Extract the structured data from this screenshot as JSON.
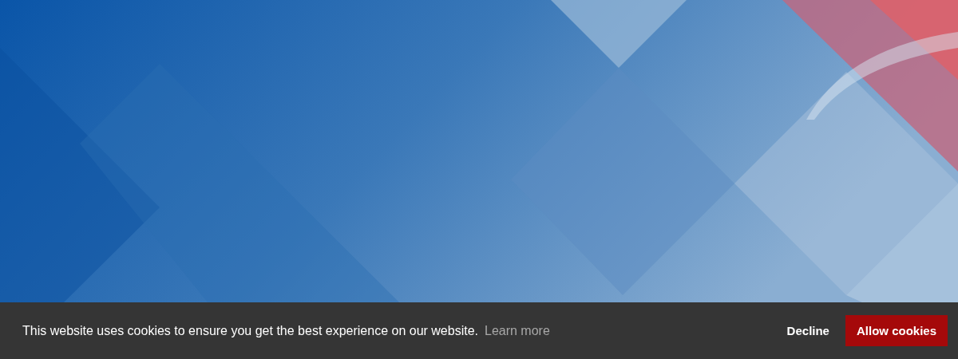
{
  "cookie_banner": {
    "message": "This website uses cookies to ensure you get the best experience on our website.",
    "link": "Learn more",
    "buttons": [
      {
        "label": "Decline",
        "kind": "text"
      },
      {
        "label": "Allow cookies",
        "kind": "primary"
      }
    ]
  }
}
